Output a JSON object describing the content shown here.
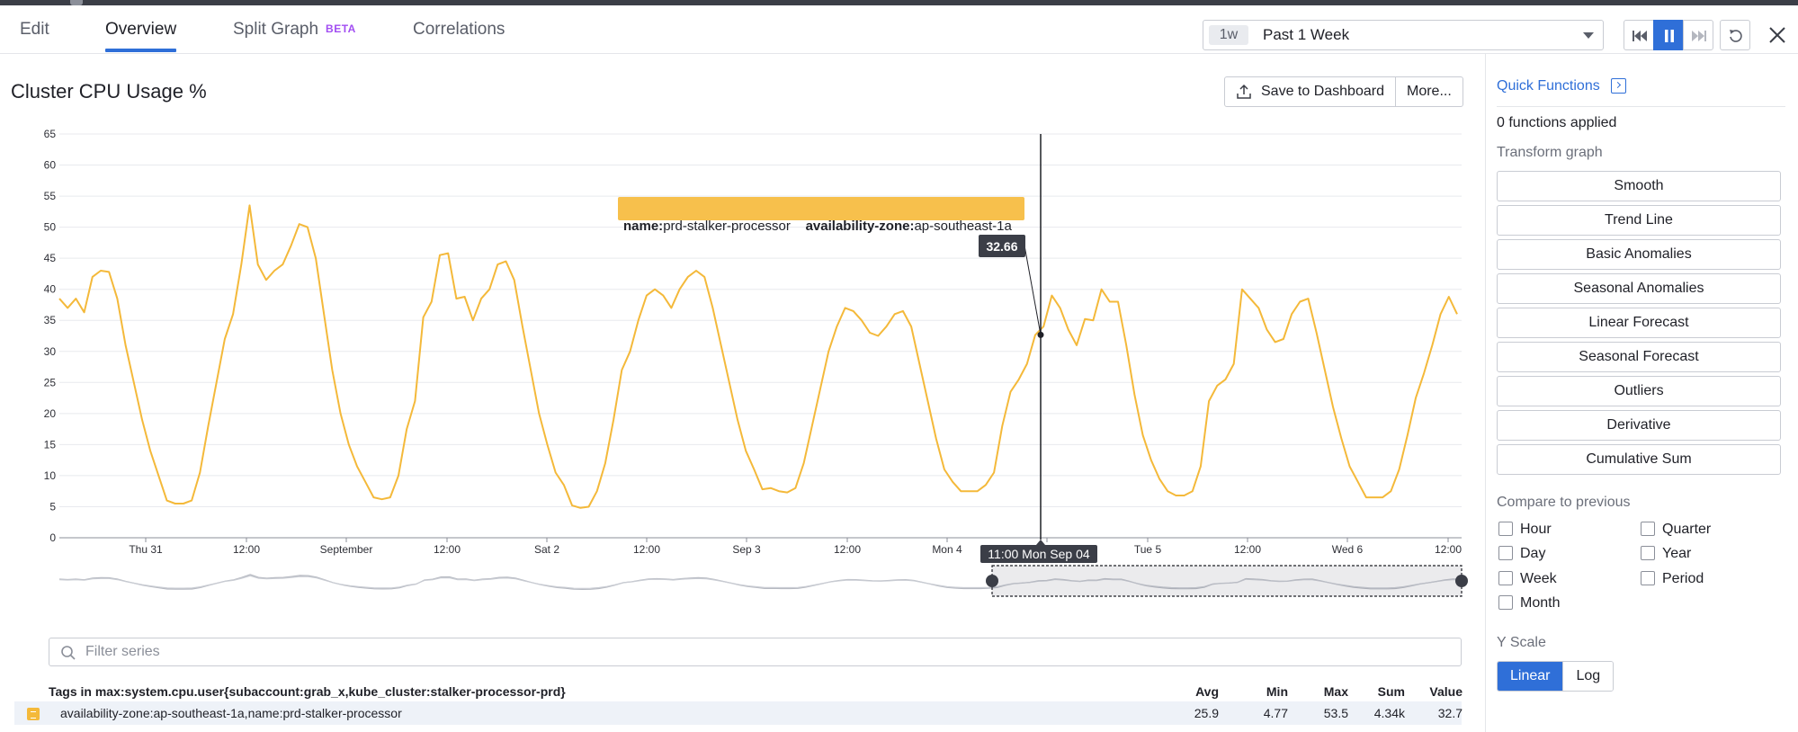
{
  "tabs": [
    {
      "label": "Edit",
      "active": false
    },
    {
      "label": "Overview",
      "active": true
    },
    {
      "label": "Split Graph",
      "badge": "BETA",
      "active": false
    },
    {
      "label": "Correlations",
      "active": false
    }
  ],
  "time_selector": {
    "short": "1w",
    "label": "Past 1 Week"
  },
  "graph": {
    "title": "Cluster CPU Usage %",
    "save_label": "Save to Dashboard",
    "more_label": "More..."
  },
  "tooltip": {
    "tag1_key": "name:",
    "tag1_value": "prd-stalker-processor",
    "tag2_key": "availability-zone:",
    "tag2_value": "ap-southeast-1a",
    "value": "32.66",
    "time": "11:00 Mon Sep 04"
  },
  "chart_data": {
    "type": "line",
    "ylim": [
      0,
      65
    ],
    "y_ticks": [
      "0",
      "5",
      "10",
      "15",
      "20",
      "25",
      "30",
      "35",
      "40",
      "45",
      "50",
      "55",
      "60",
      "65"
    ],
    "x_ticks": [
      "Thu 31",
      "12:00",
      "September",
      "12:00",
      "Sat 2",
      "12:00",
      "Sep 3",
      "12:00",
      "Mon 4",
      "12:00",
      "Tue 5",
      "12:00",
      "Wed 6",
      "12:00"
    ],
    "grid": true,
    "line_color": "#f4b93a",
    "series": [
      {
        "values": [
          38.5,
          37,
          38.5,
          36.3,
          42,
          43,
          42.8,
          38.5,
          31,
          25,
          19,
          14,
          10,
          6,
          5.5,
          5.5,
          6,
          10.5,
          18,
          25,
          32,
          36,
          44,
          53.5,
          44,
          41.5,
          43,
          44,
          47,
          50.5,
          50,
          45,
          36,
          27,
          20,
          15,
          11.5,
          9,
          6.5,
          6.2,
          6.5,
          10,
          17.5,
          22,
          35.5,
          38,
          45.5,
          45.8,
          38.5,
          38.8,
          35,
          38.5,
          40,
          44,
          44.5,
          41.5,
          34,
          27,
          20,
          15,
          10.5,
          8.5,
          5.2,
          4.8,
          5,
          7.5,
          12,
          19,
          27,
          30,
          35,
          39,
          40,
          39,
          37,
          40,
          42,
          43,
          42,
          37,
          31,
          25,
          19,
          14,
          11,
          7.8,
          8,
          7.5,
          7.3,
          8,
          12,
          18,
          24,
          30,
          34,
          37,
          36.5,
          35,
          33,
          32.5,
          34,
          36,
          36.5,
          34,
          28,
          22,
          16,
          11,
          9,
          7.5,
          7.5,
          7.5,
          8.5,
          10.5,
          18,
          23.5,
          25.5,
          28,
          32.66,
          34,
          39,
          37,
          33.5,
          31,
          35.2,
          35,
          40,
          38,
          38,
          31,
          23,
          16.5,
          12.5,
          9.5,
          7.5,
          6.8,
          6.8,
          7.5,
          11.5,
          22,
          24.5,
          25.5,
          28,
          40,
          38.5,
          37,
          33.5,
          31.5,
          32,
          36,
          38,
          38.5,
          33,
          27,
          21,
          16,
          11.5,
          9,
          6.5,
          6.5,
          6.5,
          7.5,
          11,
          16.5,
          22.5,
          26.5,
          31,
          36,
          38.8,
          36
        ]
      }
    ]
  },
  "filter": {
    "placeholder": "Filter series"
  },
  "series_table": {
    "header": "Tags in max:system.cpu.user{subaccount:grab_x,kube_cluster:stalker-processor-prd}",
    "columns": [
      "Avg",
      "Min",
      "Max",
      "Sum",
      "Value"
    ],
    "rows": [
      {
        "name": "availability-zone:ap-southeast-1a,name:prd-stalker-processor",
        "color": "#f4b93a",
        "values": [
          "25.9",
          "4.77",
          "53.5",
          "4.34k",
          "32.7"
        ]
      }
    ]
  },
  "quick_functions": {
    "title": "Quick Functions",
    "applied": "0 functions applied",
    "transform_label": "Transform graph",
    "functions": [
      "Smooth",
      "Trend Line",
      "Basic Anomalies",
      "Seasonal Anomalies",
      "Linear Forecast",
      "Seasonal Forecast",
      "Outliers",
      "Derivative",
      "Cumulative Sum"
    ],
    "compare_label": "Compare to previous",
    "compare_options": [
      "Hour",
      "Quarter",
      "Day",
      "Year",
      "Week",
      "Period",
      "Month"
    ],
    "yscale_label": "Y Scale",
    "yscale_options": [
      "Linear",
      "Log"
    ],
    "yscale_selected": "Linear"
  }
}
